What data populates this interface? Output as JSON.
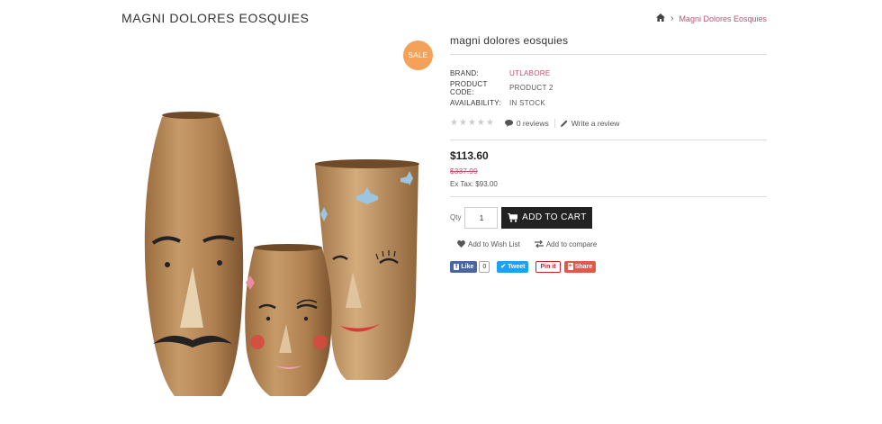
{
  "page": {
    "title": "MAGNI DOLORES EOSQUIES"
  },
  "breadcrumb": {
    "home_icon": "home-icon",
    "separator": "›",
    "current": "Magni Dolores Eosquies"
  },
  "badge": {
    "label": "SALE",
    "color": "#f4a15a"
  },
  "product": {
    "name": "magni dolores eosquies",
    "specs": {
      "brand_label": "BRAND:",
      "brand_value": "UTLABORE",
      "code_label": "PRODUCT CODE:",
      "code_value": "PRODUCT 2",
      "availability_label": "AVAILABILITY:",
      "availability_value": "IN STOCK"
    },
    "rating": {
      "stars": 0,
      "max": 5,
      "reviews_label": "0 reviews",
      "write_label": "Write a review"
    },
    "price": {
      "current": "$113.60",
      "old": "$337.99",
      "ex_tax": "Ex Tax: $93.00"
    }
  },
  "cart": {
    "qty_label": "Qty",
    "qty_value": "1",
    "button_label": "ADD TO CART"
  },
  "actions": {
    "wishlist": "Add to Wish List",
    "compare": "Add to compare"
  },
  "social": {
    "like": "Like",
    "like_count": "0",
    "tweet": "Tweet",
    "pin": "Pin it",
    "share": "Share"
  },
  "colors": {
    "accent": "#c0536d",
    "button": "#222222"
  }
}
